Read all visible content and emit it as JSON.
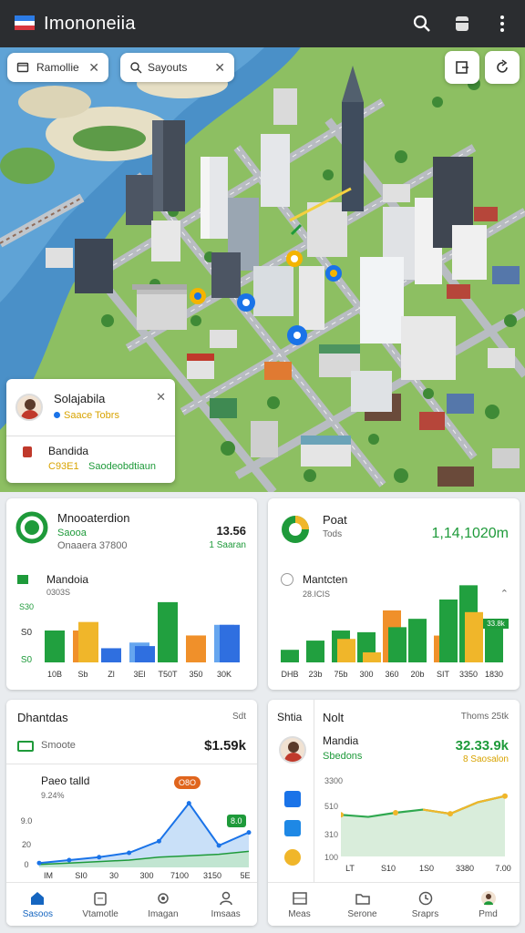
{
  "app": {
    "title": "Imononeiia"
  },
  "map_ui": {
    "chips": [
      {
        "label": "Ramollie"
      },
      {
        "label": "Sayouts"
      }
    ],
    "popup": {
      "name": "Solajabila",
      "subtitle": "Saace Tobrs",
      "item_title": "Bandida",
      "item_code": "C93E1",
      "item_desc": "Saodeobdtiaun"
    }
  },
  "card1": {
    "title": "Mnooaterdion",
    "sub1": "Saooa",
    "sub2": "Onaaera 37800",
    "value": "13.56",
    "value_sub": "1 Saaran",
    "chart_title": "Mandoia",
    "chart_sub": "0303S"
  },
  "card2": {
    "title": "Poat",
    "sub": "Tods",
    "value": "1,14,1020m",
    "chart_title": "Mantcten",
    "chart_sub": "28.ICIS"
  },
  "card3": {
    "title": "Dhantdas",
    "corner": "Sdt",
    "row_label": "Smoote",
    "row_value": "$1.59k",
    "chart_title": "Paeo talld",
    "chart_sub": "9.24%",
    "badge1": "O8O",
    "badge2": "8.0"
  },
  "card4": {
    "left_label": "Shtia",
    "title": "Nolt",
    "corner": "Thoms 25tk",
    "name": "Mandia",
    "sub": "Sbedons",
    "value": "32.33.9k",
    "value_sub": "8 Saosalon",
    "chart_y_top": "3300",
    "chart_y_mid": "510",
    "chart_y_low": "310",
    "chart_y_bot": "100"
  },
  "chart_data": [
    {
      "type": "bar",
      "title": "Mandoia",
      "categories": [
        "10B",
        "Sb",
        "Zl",
        "3El",
        "T50T",
        "350",
        "30K"
      ],
      "series": [
        {
          "values": [
            45,
            45,
            0,
            0,
            0,
            38,
            53
          ]
        },
        {
          "values": [
            0,
            45,
            0,
            0,
            0,
            0,
            0
          ]
        },
        {
          "values": [
            0,
            0,
            30,
            30,
            0,
            0,
            0
          ]
        },
        {
          "values": [
            0,
            0,
            0,
            28,
            23,
            0,
            0
          ]
        },
        {
          "values": [
            0,
            0,
            0,
            0,
            0,
            0,
            0
          ]
        }
      ],
      "bars": [
        {
          "x": "10B",
          "value": 45,
          "color": "#21a03f"
        },
        {
          "x": "Sb",
          "value": 45,
          "color": "#f0902a"
        },
        {
          "x": "Sb",
          "value": 57,
          "color": "#f0b62a"
        },
        {
          "x": "Zl",
          "value": 20,
          "color": "#2f6fe0"
        },
        {
          "x": "3El",
          "value": 28,
          "color": "#66a6ef"
        },
        {
          "x": "3El",
          "value": 23,
          "color": "#2f6fe0"
        },
        {
          "x": "T50T",
          "value": 85,
          "color": "#21a03f"
        },
        {
          "x": "350",
          "value": 38,
          "color": "#f0902a"
        },
        {
          "x": "30K",
          "value": 53,
          "color": "#66a6ef"
        },
        {
          "x": "30K",
          "value": 53,
          "color": "#2f6fe0"
        }
      ],
      "ytick_labels": [
        "S30",
        "S0",
        "S0"
      ]
    },
    {
      "type": "bar",
      "title": "Mantcten",
      "categories": [
        "DHB",
        "23b",
        "75b",
        "300",
        "360",
        "20b",
        "SIT",
        "3350",
        "1830"
      ],
      "bars": [
        {
          "x": "DHB",
          "value": 15,
          "color": "#21a03f"
        },
        {
          "x": "23b",
          "value": 26,
          "color": "#21a03f"
        },
        {
          "x": "75b",
          "value": 38,
          "color": "#21a03f"
        },
        {
          "x": "75b",
          "value": 28,
          "color": "#f0b62a"
        },
        {
          "x": "300",
          "value": 36,
          "color": "#21a03f"
        },
        {
          "x": "300",
          "value": 12,
          "color": "#f0b62a"
        },
        {
          "x": "360",
          "value": 62,
          "color": "#f0902a"
        },
        {
          "x": "360",
          "value": 42,
          "color": "#21a03f"
        },
        {
          "x": "20b",
          "value": 52,
          "color": "#21a03f"
        },
        {
          "x": "SIT",
          "value": 32,
          "color": "#f0902a"
        },
        {
          "x": "SIT",
          "value": 75,
          "color": "#21a03f"
        },
        {
          "x": "3350",
          "value": 92,
          "color": "#21a03f"
        },
        {
          "x": "3350",
          "value": 60,
          "color": "#f0b62a"
        },
        {
          "x": "1830",
          "value": 46,
          "color": "#21a03f"
        }
      ],
      "data_label": "33.8k"
    },
    {
      "type": "area",
      "title": "Paeo talld",
      "x": [
        "IM",
        "SI0",
        "30",
        "300",
        "7100",
        "3150",
        "5E"
      ],
      "series": [
        {
          "values": [
            6,
            10,
            14,
            20,
            36,
            88,
            30,
            48
          ]
        },
        {
          "values": [
            4,
            6,
            8,
            10,
            14,
            16,
            18,
            22
          ]
        }
      ],
      "ytick_labels": [
        "0",
        "20",
        "9.0"
      ]
    },
    {
      "type": "line",
      "x": [
        "LT",
        "S10",
        "1S0",
        "3380",
        "7.00"
      ],
      "series": [
        {
          "values": [
            40,
            38,
            42,
            45,
            41,
            52,
            58
          ]
        }
      ],
      "ytick_labels": [
        "3300",
        "510",
        "310",
        "100"
      ]
    }
  ],
  "nav_left": [
    {
      "label": "Sasoos"
    },
    {
      "label": "Vtamotle"
    },
    {
      "label": "Imagan"
    },
    {
      "label": "Imsaas"
    }
  ],
  "nav_right": [
    {
      "label": "Meas"
    },
    {
      "label": "Serone"
    },
    {
      "label": "Sraprs"
    },
    {
      "label": "Pmd"
    }
  ],
  "colors": {
    "accent_green": "#1e9a3a",
    "accent_blue": "#1565c0",
    "appbar": "#2b2d30"
  }
}
